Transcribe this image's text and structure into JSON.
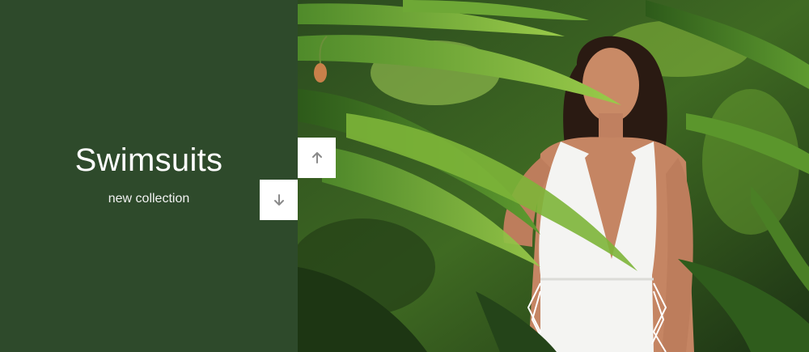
{
  "hero": {
    "title": "Swimsuits",
    "subtitle": "new collection",
    "panel_color": "#2e4a2b"
  },
  "navigation": {
    "up_icon": "arrow-up-icon",
    "down_icon": "arrow-down-icon"
  },
  "image": {
    "subject": "model-in-white-swimsuit-among-tropical-leaves"
  }
}
